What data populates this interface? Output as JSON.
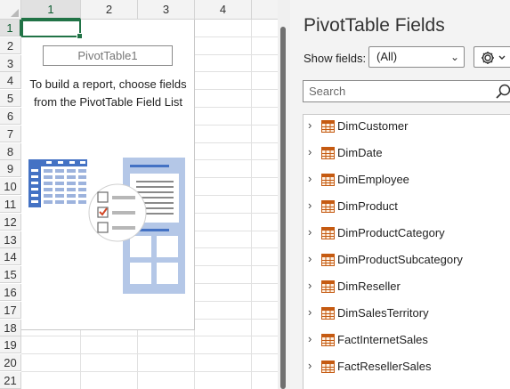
{
  "sheet": {
    "columns": [
      "1",
      "2",
      "3",
      "4"
    ],
    "rows": [
      "1",
      "2",
      "3",
      "4",
      "5",
      "6",
      "7",
      "8",
      "9",
      "10",
      "11",
      "12",
      "13",
      "14",
      "15",
      "16",
      "17",
      "18",
      "19",
      "20",
      "21"
    ],
    "pivot_table_name": "PivotTable1",
    "pivot_message": [
      "To build a report, choose fields",
      "from the PivotTable Field List"
    ]
  },
  "pane": {
    "title": "PivotTable Fields",
    "show_fields_label": "Show fields:",
    "show_fields_value": "(All)",
    "search_placeholder": "Search",
    "fields": [
      {
        "name": "DimCustomer"
      },
      {
        "name": "DimDate"
      },
      {
        "name": "DimEmployee"
      },
      {
        "name": "DimProduct"
      },
      {
        "name": "DimProductCategory"
      },
      {
        "name": "DimProductSubcategory"
      },
      {
        "name": "DimReseller"
      },
      {
        "name": "DimSalesTerritory"
      },
      {
        "name": "FactInternetSales"
      },
      {
        "name": "FactResellerSales"
      }
    ]
  },
  "colors": {
    "excel_green": "#217346",
    "illustration_blue": "#4472c4",
    "checkbox_orange": "#d24726"
  },
  "icons": {
    "expander": "chevron-right-icon",
    "table": "table-icon",
    "settings": "gear-icon",
    "search": "search-icon"
  }
}
